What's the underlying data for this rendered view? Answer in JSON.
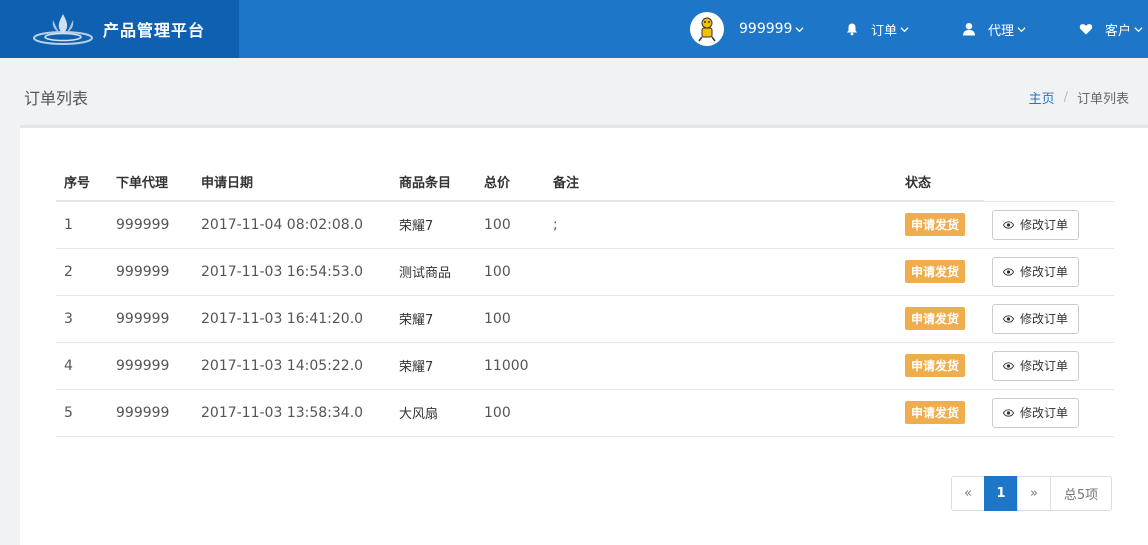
{
  "header": {
    "brand_title": "产品管理平台",
    "user_name": "999999",
    "nav": [
      {
        "label": "订单",
        "icon": "bell-icon"
      },
      {
        "label": "代理",
        "icon": "user-icon"
      },
      {
        "label": "客户",
        "icon": "heart-icon"
      }
    ],
    "colors": {
      "bar": "#1e76c8",
      "brand": "#0f60b0"
    }
  },
  "page": {
    "title": "订单列表",
    "breadcrumb": {
      "home": "主页",
      "separator": "/",
      "current": "订单列表"
    }
  },
  "table": {
    "columns": [
      "序号",
      "下单代理",
      "申请日期",
      "商品条目",
      "总价",
      "备注",
      "状态"
    ],
    "rows": [
      {
        "no": "1",
        "agent": "999999",
        "date": "2017-11-04 08:02:08.0",
        "goods": "荣耀7",
        "price": "100",
        "remark": ";",
        "status": "申请发货",
        "action": "修改订单"
      },
      {
        "no": "2",
        "agent": "999999",
        "date": "2017-11-03 16:54:53.0",
        "goods": "测试商品",
        "price": "100",
        "remark": "",
        "status": "申请发货",
        "action": "修改订单"
      },
      {
        "no": "3",
        "agent": "999999",
        "date": "2017-11-03 16:41:20.0",
        "goods": "荣耀7",
        "price": "100",
        "remark": "",
        "status": "申请发货",
        "action": "修改订单"
      },
      {
        "no": "4",
        "agent": "999999",
        "date": "2017-11-03 14:05:22.0",
        "goods": "荣耀7",
        "price": "11000",
        "remark": "",
        "status": "申请发货",
        "action": "修改订单"
      },
      {
        "no": "5",
        "agent": "999999",
        "date": "2017-11-03 13:58:34.0",
        "goods": "大风扇",
        "price": "100",
        "remark": "",
        "status": "申请发货",
        "action": "修改订单"
      }
    ],
    "status_color": "#f0ad4e"
  },
  "pagination": {
    "prev": "«",
    "current": "1",
    "next": "»",
    "total": "总5项"
  }
}
